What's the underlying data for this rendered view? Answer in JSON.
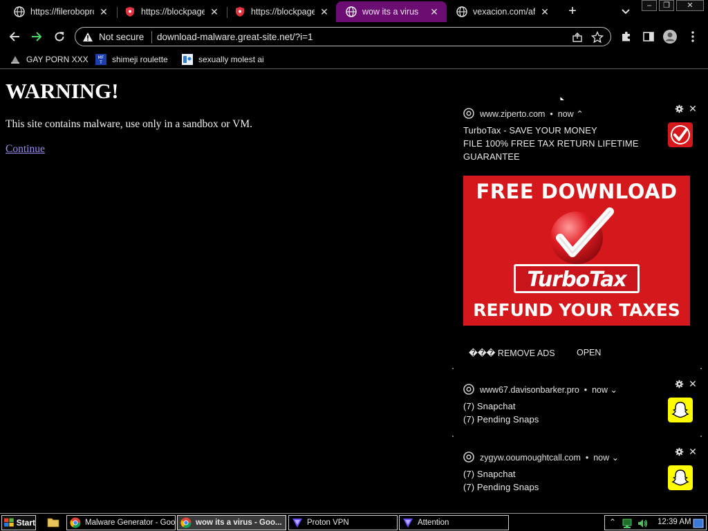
{
  "browser": {
    "tabs": [
      {
        "title": "https://fileroboprot",
        "icon": "globe-icon",
        "active": false
      },
      {
        "title": "https://blockpage",
        "icon": "shield-icon",
        "active": false
      },
      {
        "title": "https://blockpage",
        "icon": "shield-icon",
        "active": false
      },
      {
        "title": "wow its a virus",
        "icon": "globe-icon",
        "active": true
      },
      {
        "title": "vexacion.com/afu",
        "icon": "globe-icon",
        "active": false
      }
    ],
    "tab_close_glyph": "✕",
    "new_tab_glyph": "+",
    "window_controls": [
      "–",
      "❐",
      "✕"
    ],
    "security_label": "Not secure",
    "url": "download-malware.great-site.net/?i=1",
    "bookmarks": [
      {
        "label": "GAY PORN XXX",
        "icon": "bookmark-favicon-1"
      },
      {
        "label": "shimeji roulette",
        "icon": "bookmark-favicon-2"
      },
      {
        "label": "sexually molest ai",
        "icon": "bookmark-favicon-3"
      }
    ]
  },
  "page": {
    "title": "WARNING!",
    "message": "This site contains malware, use only in a sandbox or VM.",
    "link": "Continue"
  },
  "notifications": [
    {
      "source": "www.ziperto.com",
      "time": "now",
      "expand_glyph": "⌃",
      "lines": [
        "TurboTax - SAVE YOUR MONEY",
        "FILE 100% FREE TAX RETURN LIFETIME",
        "GUARANTEE"
      ],
      "app_icon": "turbotax-check-icon",
      "image": {
        "headline": "FREE DOWNLOAD",
        "brand": "TurboTax",
        "footer": "REFUND YOUR TAXES"
      },
      "actions": [
        "��� REMOVE ADS",
        "OPEN"
      ]
    },
    {
      "source": "www67.davisonbarker.pro",
      "time": "now",
      "expand_glyph": "⌄",
      "lines": [
        "(7) Snapchat",
        "(7) Pending Snaps"
      ],
      "app_icon": "snapchat-ghost-icon"
    },
    {
      "source": "zygyw.ooumoughtcall.com",
      "time": "now",
      "expand_glyph": "⌄",
      "lines": [
        "(7) Snapchat",
        "(7) Pending Snaps"
      ],
      "app_icon": "snapchat-ghost-icon"
    }
  ],
  "taskbar": {
    "start_label": "Start",
    "buttons": [
      {
        "label": "Malware Generator - Goo...",
        "icon": "chrome-icon",
        "pressed": false
      },
      {
        "label": "wow its a virus - Goo...",
        "icon": "chrome-icon",
        "pressed": true
      },
      {
        "label": "Proton VPN",
        "icon": "proton-vpn-icon",
        "pressed": false
      },
      {
        "label": "Attention",
        "icon": "proton-vpn-icon",
        "pressed": false
      }
    ],
    "tray_expand_glyph": "⌃",
    "clock": "12:39 AM"
  },
  "colors": {
    "active_tab": "#6b0d73",
    "link": "#9a8ff0",
    "turbotax_red": "#d5181b",
    "snapchat_yellow": "#fffc00"
  }
}
